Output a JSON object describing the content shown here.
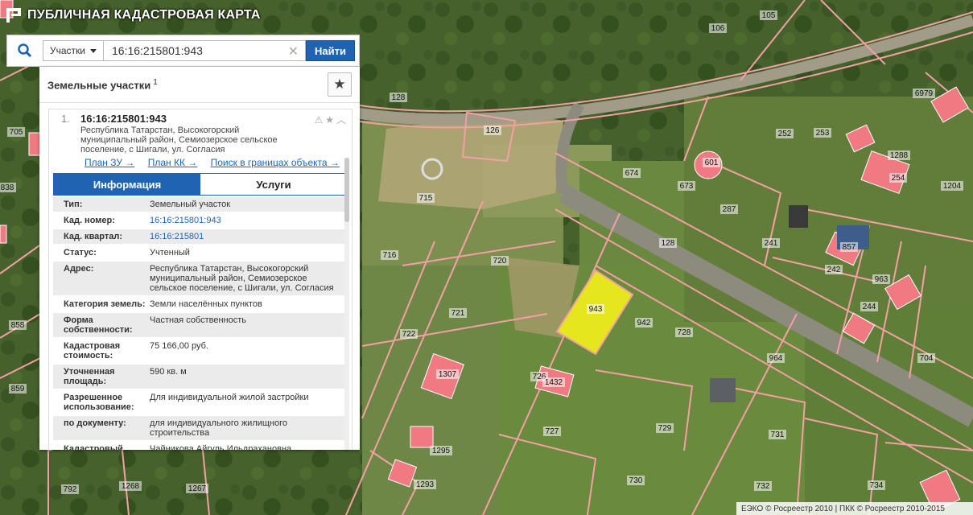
{
  "app": {
    "title": "ПУБЛИЧНАЯ КАДАСТРОВАЯ КАРТА"
  },
  "search": {
    "type_label": "Участки",
    "query": "16:16:215801:943",
    "button_label": "Найти"
  },
  "results": {
    "title": "Земельные участки",
    "count": "1",
    "item": {
      "index": "1.",
      "cad_number": "16:16:215801:943",
      "address": "Республика Татарстан, Высокогорский муниципальный район, Семиозерское сельское поселение, с Шигали, ул. Согласия",
      "links": [
        "План ЗУ →",
        "План КК →",
        "Поиск в границах объекта →"
      ],
      "tabs": [
        "Информация",
        "Услуги"
      ],
      "properties": [
        {
          "label": "Тип:",
          "value": "Земельный участок"
        },
        {
          "label": "Кад. номер:",
          "value": "16:16:215801:943",
          "link": true
        },
        {
          "label": "Кад. квартал:",
          "value": "16:16:215801",
          "link": true
        },
        {
          "label": "Статус:",
          "value": "Учтенный"
        },
        {
          "label": "Адрес:",
          "value": "Республика Татарстан, Высокогорский муниципальный район, Семиозерское сельское поселение, с Шигали, ул. Согласия"
        },
        {
          "label": "Категория земель:",
          "value": "Земли населённых пунктов"
        },
        {
          "label": "Форма собственности:",
          "value": "Частная собственность"
        },
        {
          "label": "Кадастровая стоимость:",
          "value": "75 166,00 руб."
        },
        {
          "label": "Уточненная площадь:",
          "value": "590 кв. м"
        },
        {
          "label": "Разрешенное использование:",
          "value": "Для индивидуальной жилой застройки"
        },
        {
          "label": "по документу:",
          "value": "для индивидуального жилищного строительства"
        },
        {
          "label": "Кадастровый инженер:",
          "value": "Чайникова Айгуль Ильдрахановна"
        }
      ]
    }
  },
  "map": {
    "labels": [
      "105",
      "106",
      "128",
      "126",
      "715",
      "716",
      "720",
      "721",
      "722",
      "943",
      "942",
      "728",
      "726",
      "727",
      "729",
      "730",
      "731",
      "734",
      "732",
      "674",
      "673",
      "601",
      "287",
      "241",
      "242",
      "252",
      "253",
      "1288",
      "254",
      "1204",
      "6979",
      "128",
      "964",
      "963",
      "244",
      "704",
      "705",
      "838",
      "858",
      "859",
      "792",
      "1268",
      "1267",
      "1295",
      "1293",
      "1307",
      "1432",
      "857"
    ],
    "colors": {
      "parcel_border": "#f2a0a4",
      "highlight": "#e6e61e",
      "building": "#f07a82",
      "road": "#9b9b8e"
    }
  },
  "footer": {
    "text": "ЕЭКО © Росреестр 2010 | ПКК © Росреестр 2010-2015"
  }
}
